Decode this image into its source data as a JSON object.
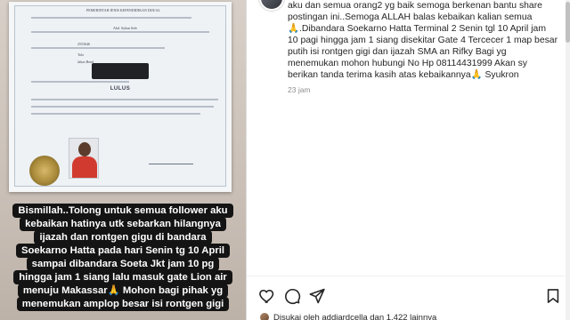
{
  "media": {
    "document": {
      "status_label": "LULUS",
      "header_line": "PEMERINTAH JENIS KEPENDIDIKAN DIJUAL",
      "field_name": "Abd. Syban Sefe",
      "field_number": "2553646",
      "field_place": "Tolo",
      "field_date": "Jakas Bend"
    },
    "caption_lines": [
      "Bismillah..Tolong untuk semua follower aku",
      "kebaikan hatinya utk sebarkan hilangnya",
      "ijazah dan rontgen gigu di bandara",
      "Soekarno Hatta pada hari  Senin tg 10 April",
      "sampai dibandara Soeta Jkt jam 10 pg",
      "hingga jam 1 siang lalu masuk gate Lion air",
      "menuju Makassar🙏 Mohon bagi pihak yg",
      "menemukan amplop besar isi rontgen gigi"
    ]
  },
  "post": {
    "comment_lines": [
      "aku dan semua orang2 yg baik semoga berkenan bantu share",
      "postingan ini..Semoga ALLAH balas kebaikan kalian semua",
      "🙏.Dibandara Soekarno Hatta Terminal 2 Senin tgl 10 April jam",
      "10 pagi hingga jam 1 siang disekitar Gate 4 Tercecer 1 map besar",
      "putih isi rontgen gigi dan ijazah SMA an Rifky Bagi yg",
      "menemukan mohon hubungi No Hp 08114431999 Akan sy",
      "berikan tanda terima kasih atas kebaikannya🙏 Syukron"
    ],
    "timestamp": "23 jam",
    "likes_text": "Disukai oleh addiardcella dan 1.422 lainnya"
  },
  "actions": {
    "icons": [
      "heart-icon",
      "comment-icon",
      "share-icon",
      "bookmark-icon"
    ]
  },
  "colors": {
    "text": "#262626",
    "secondary": "#8e8e8e",
    "caption_bg": "#141414",
    "divider": "#dbdbdb"
  }
}
